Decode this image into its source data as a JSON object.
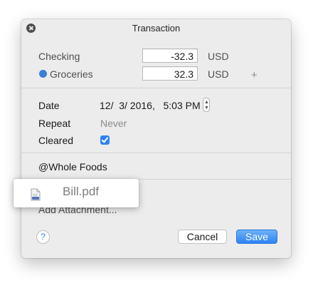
{
  "dialog": {
    "title": "Transaction",
    "close_icon": "close-icon"
  },
  "splits": [
    {
      "account": "Checking",
      "amount": "-32.3",
      "currency": "USD"
    },
    {
      "account": "Groceries",
      "amount": "32.3",
      "currency": "USD",
      "dot_color": "#3a7fd6"
    }
  ],
  "add_split_label": "+",
  "details": {
    "date_label": "Date",
    "date_value": "12/  3/ 2016,   5:03 PM",
    "repeat_label": "Repeat",
    "repeat_value": "Never",
    "cleared_label": "Cleared",
    "cleared_checked": true
  },
  "payee": "@Whole Foods",
  "attachment": {
    "dragged_file": "Bill.pdf",
    "add_label": "Add Attachment..."
  },
  "footer": {
    "help_label": "?",
    "cancel_label": "Cancel",
    "save_label": "Save"
  },
  "colors": {
    "accent": "#2f83f4",
    "groceries_dot": "#3a7fd6"
  }
}
